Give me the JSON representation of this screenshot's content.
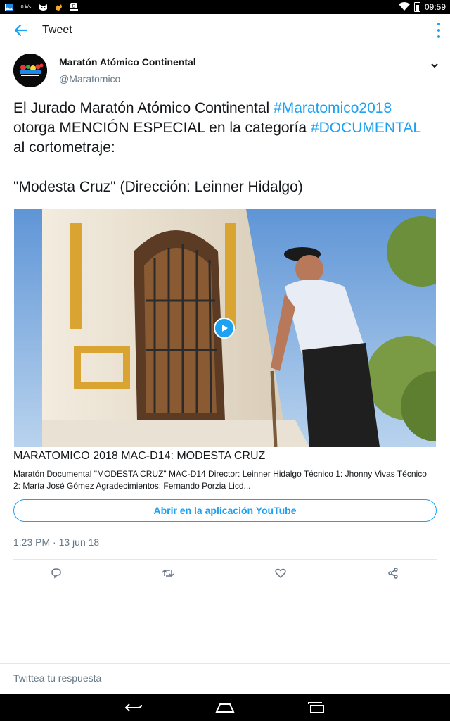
{
  "statusbar": {
    "time": "09:59",
    "notif_icons": [
      "gallery-icon",
      "data-speed-icon",
      "cat-icon",
      "hand-icon",
      "app-icon"
    ],
    "speed_label": "0 k/s"
  },
  "header": {
    "title": "Tweet"
  },
  "tweet": {
    "author_name": "Maratón Atómico Continental",
    "author_handle": "@Maratomico",
    "text_line1_pre": "El Jurado Maratón Atómico Continental ",
    "text_line1_tag": "#Maratomico2018",
    "text_line2_pre": " otorga MENCIÓN ESPECIAL en la categoría ",
    "text_line2_tag": "#DOCUMENTAL",
    "text_line3": " al cortometraje:",
    "text_quote": "\"Modesta Cruz\" (Dirección: Leinner Hidalgo)",
    "timestamp": "1:23 PM · 13 jun 18"
  },
  "card": {
    "title": "MARATOMICO 2018 MAC-D14: MODESTA CRUZ",
    "description": "Maratón Documental \"MODESTA CRUZ\" MAC-D14 Director: Leinner Hidalgo Técnico 1: Jhonny Vivas Técnico 2: María José Gómez Agradecimientos: Fernando Porzia Licd...",
    "open_button": "Abrir en la aplicación YouTube"
  },
  "actions": {
    "reply": "reply-icon",
    "retweet": "retweet-icon",
    "like": "heart-icon",
    "share": "share-icon"
  },
  "reply_bar": {
    "placeholder": "Twittea tu respuesta"
  },
  "colors": {
    "accent": "#1da1f2",
    "muted": "#657786",
    "border": "#e1e8ed"
  }
}
